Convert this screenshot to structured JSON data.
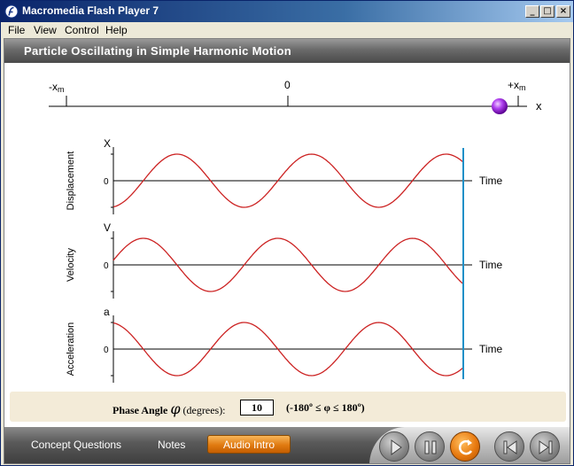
{
  "window": {
    "title": "Macromedia Flash Player 7",
    "minimize_glyph": "_",
    "maximize_glyph": "□",
    "close_glyph": "×"
  },
  "menu": [
    "File",
    "View",
    "Control",
    "Help"
  ],
  "header": {
    "title": "Particle Oscillating in Simple Harmonic Motion"
  },
  "axis": {
    "neg_label": "-x",
    "neg_sub": "m",
    "zero_label": "0",
    "pos_label": "+x",
    "pos_sub": "m",
    "x_label": "x",
    "particle_color": "#a020f0"
  },
  "chart_data": [
    {
      "type": "line",
      "ylabel": "Displacement",
      "y_symbol": "X",
      "zero_label": "0",
      "xlabel": "Time",
      "series": [
        {
          "function": "cos",
          "amplitude": 1,
          "cycles": 2.6,
          "phase_deg": 10
        }
      ],
      "color": "#cc2222"
    },
    {
      "type": "line",
      "ylabel": "Velocity",
      "y_symbol": "V",
      "zero_label": "0",
      "xlabel": "Time",
      "series": [
        {
          "function": "-sin",
          "amplitude": 1,
          "cycles": 2.6,
          "phase_deg": 10
        }
      ],
      "color": "#cc2222"
    },
    {
      "type": "line",
      "ylabel": "Acceleration",
      "y_symbol": "a",
      "zero_label": "0",
      "xlabel": "Time",
      "series": [
        {
          "function": "-cos",
          "amplitude": 1,
          "cycles": 2.6,
          "phase_deg": 10
        }
      ],
      "color": "#cc2222"
    }
  ],
  "time_cursor_color": "#1e90c8",
  "phase": {
    "label": "Phase Angle",
    "symbol": "φ",
    "unit": "(degrees):",
    "value": "10",
    "range": "(-180º ≤ φ ≤ 180º)"
  },
  "footer": {
    "concept_questions": "Concept Questions",
    "notes": "Notes",
    "audio_intro": "Audio Intro"
  },
  "controls": {
    "play_icon": "play-icon",
    "pause_icon": "pause-icon",
    "replay_icon": "replay-icon",
    "prev_icon": "skip-back-icon",
    "next_icon": "skip-forward-icon"
  }
}
